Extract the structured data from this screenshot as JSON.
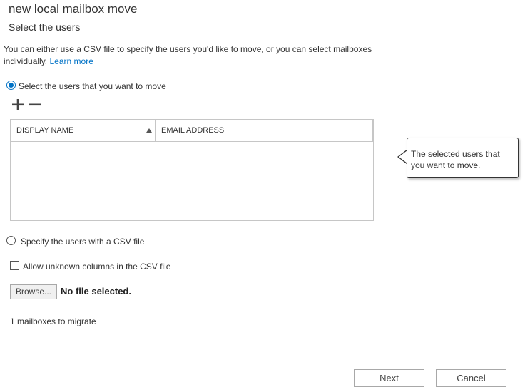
{
  "header": {
    "title": "new local mailbox move",
    "subtitle": "Select the users"
  },
  "description": {
    "text": "You can either use a CSV file to specify the users you'd like to move, or you can select mailboxes individually.",
    "link": "Learn more"
  },
  "options": {
    "select_users": {
      "label": "Select the users that you want to move",
      "checked": true
    },
    "csv": {
      "label": "Specify the users with a CSV file",
      "checked": false
    }
  },
  "toolbar": {
    "add_icon": "plus-icon",
    "remove_icon": "minus-icon"
  },
  "grid": {
    "columns": [
      "DISPLAY NAME",
      "EMAIL ADDRESS"
    ],
    "sort_icon": "sort-ascending-icon",
    "rows": []
  },
  "callout": {
    "text": "The selected users that you want to move."
  },
  "csv_options": {
    "allow_unknown_label": "Allow unknown columns in the CSV file",
    "browse_label": "Browse...",
    "file_status": "No file selected."
  },
  "status": {
    "count_text": "1 mailboxes to migrate"
  },
  "footer": {
    "next_label": "Next",
    "cancel_label": "Cancel"
  },
  "colors": {
    "accent": "#0072c6",
    "border": "#c6c6c6"
  }
}
